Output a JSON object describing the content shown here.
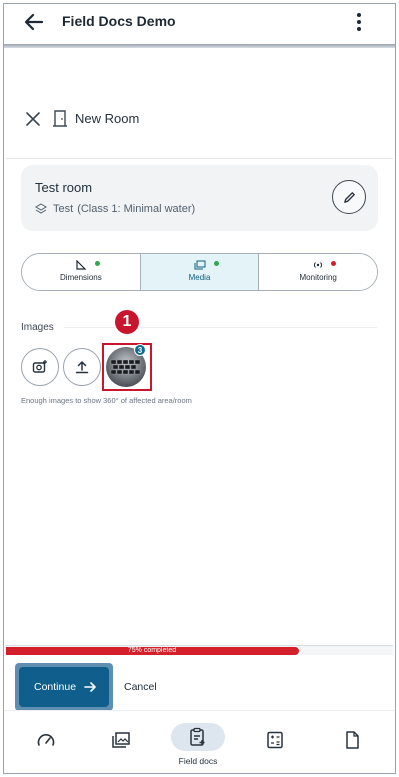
{
  "appbar": {
    "title": "Field Docs Demo"
  },
  "sheet": {
    "title": "New Room",
    "room": {
      "name": "Test room",
      "area": "Test",
      "class": "(Class 1: Minimal water)"
    }
  },
  "tabs": [
    {
      "label": "Dimensions",
      "status_color": "#2fa84f",
      "active": false
    },
    {
      "label": "Media",
      "status_color": "#2fa84f",
      "active": true
    },
    {
      "label": "Monitoring",
      "status_color": "#d4202a",
      "active": false
    }
  ],
  "images": {
    "label": "Images",
    "count_badge": "3",
    "hint": "Enough images to show 360° of affected area/room"
  },
  "callout": "1",
  "progress": {
    "percent": 75,
    "label": "75% completed"
  },
  "actions": {
    "continue": "Continue",
    "cancel": "Cancel"
  },
  "bottom_nav": {
    "items": [
      "gauge-icon",
      "gallery-icon",
      "field-docs-icon",
      "calculator-icon",
      "document-icon"
    ],
    "active_label": "Field docs"
  },
  "colors": {
    "primary": "#0f5e8c",
    "highlight": "#c8162e",
    "progress": "#d4202a",
    "active_tab_bg": "#e3f3f8"
  }
}
